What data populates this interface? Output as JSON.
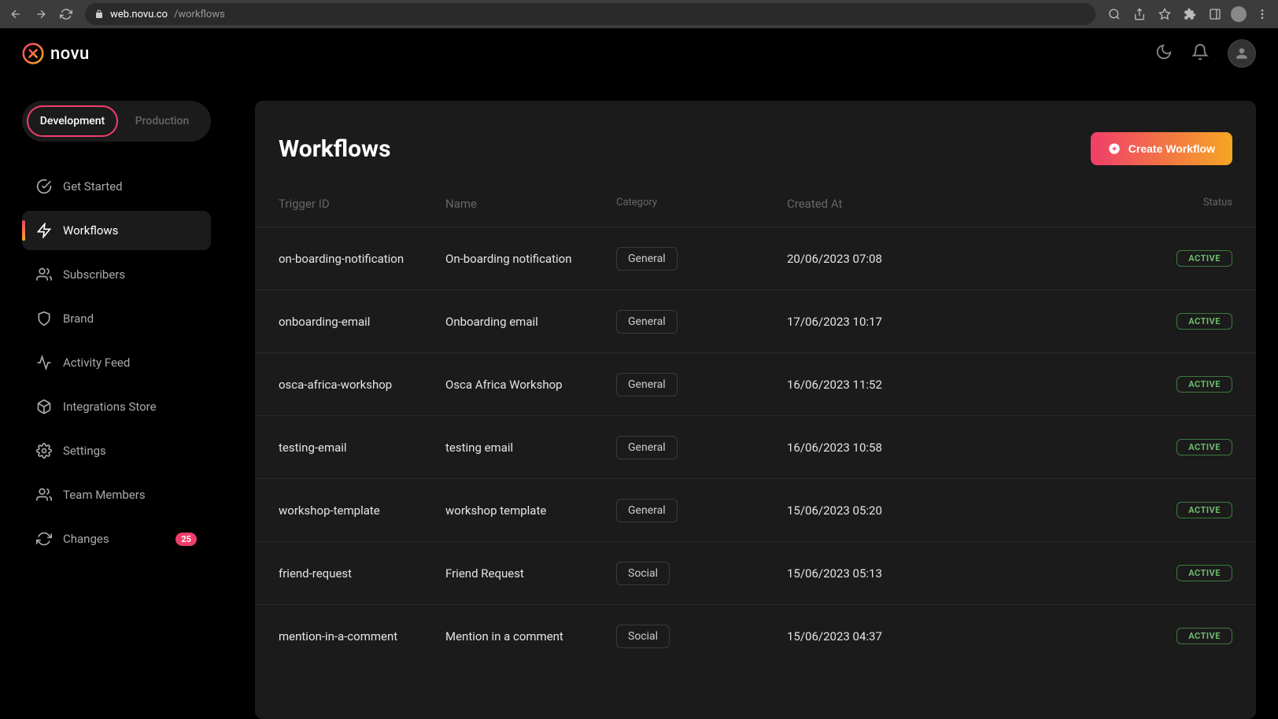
{
  "browser": {
    "url_domain": "web.novu.co",
    "url_path": "/workflows"
  },
  "logo_text": "novu",
  "env_tabs": {
    "development": "Development",
    "production": "Production"
  },
  "sidebar": {
    "items": [
      {
        "label": "Get Started"
      },
      {
        "label": "Workflows"
      },
      {
        "label": "Subscribers"
      },
      {
        "label": "Brand"
      },
      {
        "label": "Activity Feed"
      },
      {
        "label": "Integrations Store"
      },
      {
        "label": "Settings"
      },
      {
        "label": "Team Members"
      },
      {
        "label": "Changes",
        "badge": "25"
      }
    ]
  },
  "main": {
    "title": "Workflows",
    "create_label": "Create Workflow",
    "columns": {
      "trigger": "Trigger ID",
      "name": "Name",
      "category": "Category",
      "created": "Created At",
      "status": "Status"
    },
    "rows": [
      {
        "trigger": "on-boarding-notification",
        "name": "On-boarding notification",
        "category": "General",
        "created": "20/06/2023 07:08",
        "status": "ACTIVE"
      },
      {
        "trigger": "onboarding-email",
        "name": "Onboarding email",
        "category": "General",
        "created": "17/06/2023 10:17",
        "status": "ACTIVE"
      },
      {
        "trigger": "osca-africa-workshop",
        "name": "Osca Africa Workshop",
        "category": "General",
        "created": "16/06/2023 11:52",
        "status": "ACTIVE"
      },
      {
        "trigger": "testing-email",
        "name": "testing email",
        "category": "General",
        "created": "16/06/2023 10:58",
        "status": "ACTIVE"
      },
      {
        "trigger": "workshop-template",
        "name": "workshop template",
        "category": "General",
        "created": "15/06/2023 05:20",
        "status": "ACTIVE"
      },
      {
        "trigger": "friend-request",
        "name": "Friend Request",
        "category": "Social",
        "created": "15/06/2023 05:13",
        "status": "ACTIVE"
      },
      {
        "trigger": "mention-in-a-comment",
        "name": "Mention in a comment",
        "category": "Social",
        "created": "15/06/2023 04:37",
        "status": "ACTIVE"
      }
    ]
  }
}
